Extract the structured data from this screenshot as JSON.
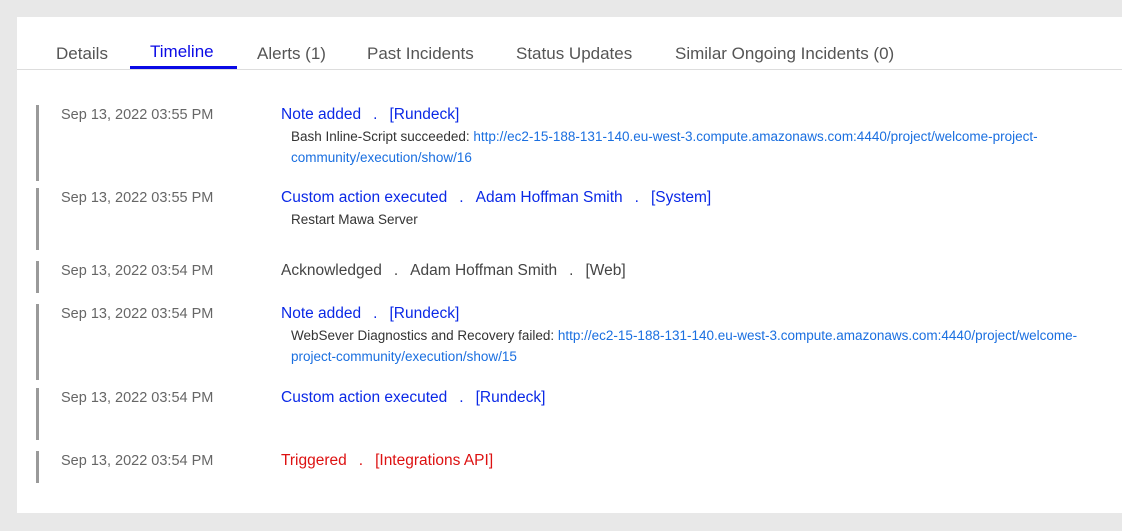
{
  "tabs": [
    {
      "label": "Details",
      "active": false
    },
    {
      "label": "Timeline",
      "active": true
    },
    {
      "label": "Alerts (1)",
      "active": false
    },
    {
      "label": "Past Incidents",
      "active": false
    },
    {
      "label": "Status Updates",
      "active": false
    },
    {
      "label": "Similar Ongoing Incidents (0)",
      "active": false
    }
  ],
  "colors": {
    "accent": "#0a0ae6",
    "link": "#1a6fe0",
    "event_blue": "#0a28e6",
    "event_red": "#dd1111",
    "event_neutral": "#444444",
    "timeline_bar": "#9a9a9a",
    "background": "#e8e8e8"
  },
  "separator": ".",
  "timeline": [
    {
      "timestamp": "Sep 13, 2022 03:55 PM",
      "event": "Note added",
      "actor": null,
      "source": "[Rundeck]",
      "color": "blue",
      "detail_text": "Bash Inline-Script succeeded: ",
      "detail_link": "http://ec2-15-188-131-140.eu-west-3.compute.amazonaws.com:4440/project/welcome-project-community/execution/show/16"
    },
    {
      "timestamp": "Sep 13, 2022 03:55 PM",
      "event": "Custom action executed",
      "actor": "Adam Hoffman Smith",
      "source": "[System]",
      "color": "blue",
      "detail_text": "Restart Mawa Server",
      "detail_link": null
    },
    {
      "timestamp": "Sep 13, 2022 03:54 PM",
      "event": "Acknowledged",
      "actor": "Adam Hoffman Smith",
      "source": "[Web]",
      "color": "dark",
      "detail_text": null,
      "detail_link": null
    },
    {
      "timestamp": "Sep 13, 2022 03:54 PM",
      "event": "Note added",
      "actor": null,
      "source": "[Rundeck]",
      "color": "blue",
      "detail_text": "WebSever Diagnostics and Recovery failed: ",
      "detail_link": "http://ec2-15-188-131-140.eu-west-3.compute.amazonaws.com:4440/project/welcome-project-community/execution/show/15"
    },
    {
      "timestamp": "Sep 13, 2022 03:54 PM",
      "event": "Custom action executed",
      "actor": null,
      "source": "[Rundeck]",
      "color": "blue",
      "detail_text": null,
      "detail_link": null
    },
    {
      "timestamp": "Sep 13, 2022 03:54 PM",
      "event": "Triggered",
      "actor": null,
      "source": "[Integrations API]",
      "color": "red",
      "detail_text": null,
      "detail_link": null
    }
  ]
}
